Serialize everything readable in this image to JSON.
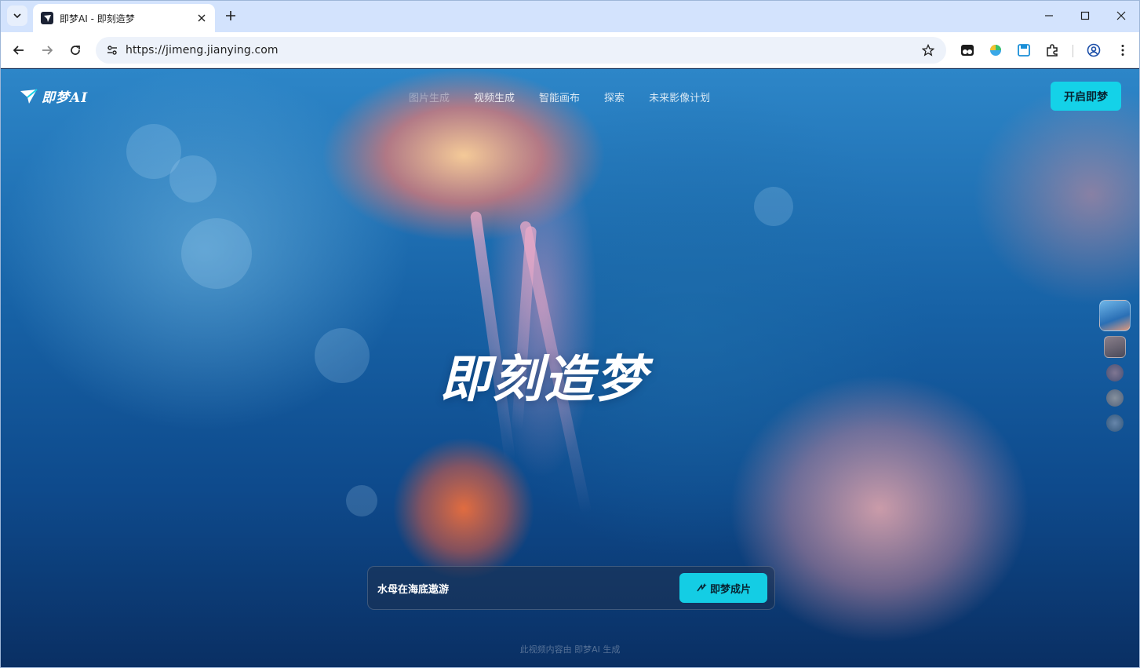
{
  "browser": {
    "tab_title": "即梦AI - 即刻造梦",
    "url": "https://jimeng.jianying.com",
    "icons": [
      "tab-search-icon",
      "close-icon",
      "new-tab-icon",
      "minimize-icon",
      "maximize-icon",
      "window-close-icon",
      "back-icon",
      "forward-icon",
      "reload-icon",
      "site-info-icon",
      "bookmark-star-icon",
      "extension-icon",
      "profile-icon",
      "more-menu-icon"
    ]
  },
  "nav": {
    "logo_text": "即梦AI",
    "items": [
      {
        "label": "图片生成",
        "active": true
      },
      {
        "label": "视频生成",
        "active": false
      },
      {
        "label": "智能画布",
        "active": false
      },
      {
        "label": "探索",
        "active": false
      },
      {
        "label": "未来影像计划",
        "active": false
      }
    ],
    "cta_label": "开启即梦"
  },
  "hero": {
    "title": "即刻造梦",
    "prompt": "水母在海底遨游",
    "generate_label": "即梦成片",
    "footer_note": "此视频内容由 即梦AI 生成"
  },
  "colors": {
    "accent": "#14d2e8",
    "tab_strip": "#d3e3fd"
  }
}
